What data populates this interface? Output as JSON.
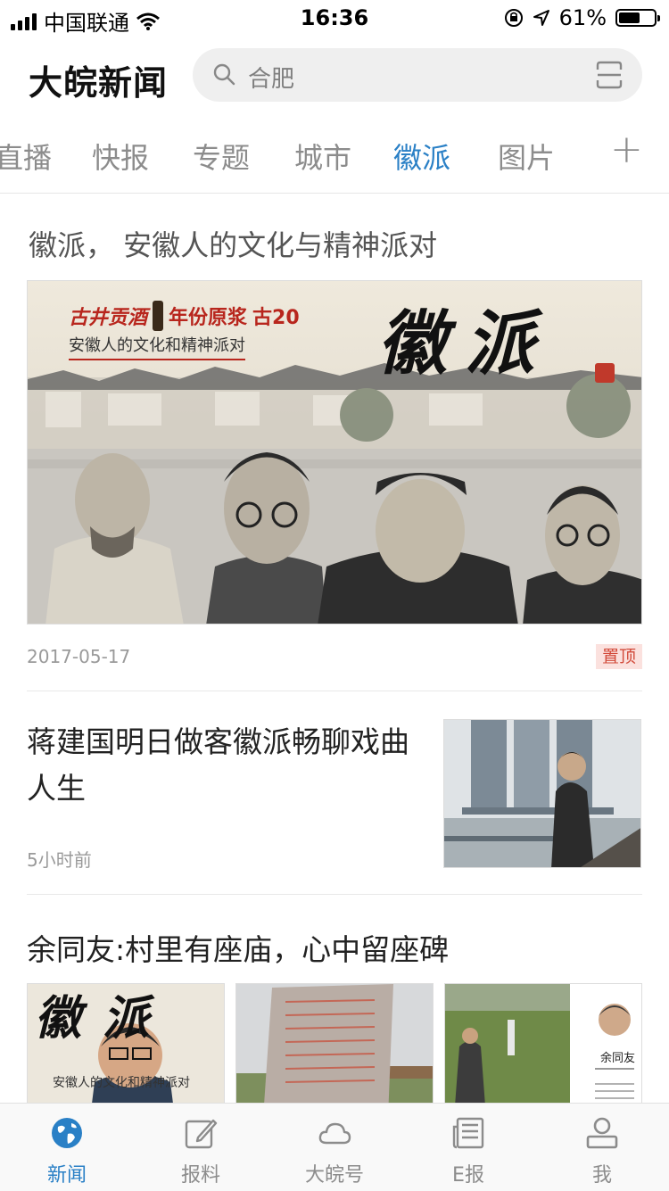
{
  "status_bar": {
    "carrier": "中国联通",
    "time": "16:36",
    "battery_percent": "61%",
    "battery_level": 0.61
  },
  "header": {
    "logo": "大皖新闻",
    "search_placeholder": "合肥"
  },
  "tabs": [
    {
      "label": "直播",
      "active": false
    },
    {
      "label": "快报",
      "active": false
    },
    {
      "label": "专题",
      "active": false
    },
    {
      "label": "城市",
      "active": false
    },
    {
      "label": "徽派",
      "active": true
    },
    {
      "label": "图片",
      "active": false
    }
  ],
  "tab_add_label": "+",
  "feature": {
    "title": "徽派， 安徽人的文化与精神派对",
    "banner": {
      "brand": "古井贡酒",
      "product": "年份原浆",
      "model": "古20",
      "slogan": "安徽人的文化和精神派对",
      "calligraphy": "徽派"
    },
    "date": "2017-05-17",
    "badge": "置顶"
  },
  "article2": {
    "title": "蒋建国明日做客徽派畅聊戏曲人生",
    "time": "5小时前"
  },
  "article3": {
    "title": "余同友:村里有座庙，心中留座碑",
    "thumb1_calligraphy": "徽派",
    "thumb1_slogan": "安徽人的文化和精神派对",
    "thumb3_caption": "余同友"
  },
  "tabbar": [
    {
      "label": "新闻",
      "icon": "globe-icon",
      "active": true
    },
    {
      "label": "报料",
      "icon": "edit-icon",
      "active": false
    },
    {
      "label": "大皖号",
      "icon": "cloud-icon",
      "active": false
    },
    {
      "label": "E报",
      "icon": "newspaper-icon",
      "active": false
    },
    {
      "label": "我",
      "icon": "user-icon",
      "active": false
    }
  ],
  "colors": {
    "accent": "#2a80c6",
    "badge_bg": "#fbe1de",
    "badge_text": "#d24a3a",
    "brand_red": "#b8261d"
  }
}
